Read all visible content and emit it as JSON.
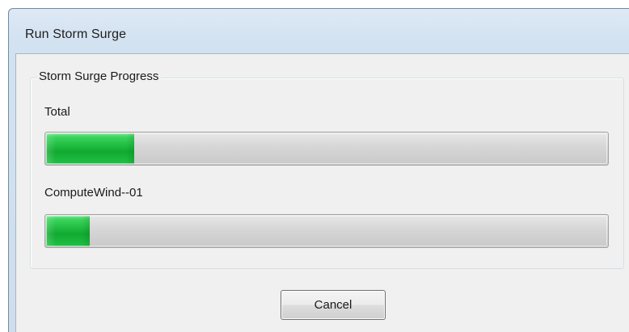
{
  "window": {
    "title": "Run Storm Surge"
  },
  "group": {
    "legend": "Storm Surge Progress"
  },
  "progress": {
    "total": {
      "label": "Total",
      "value_percent": 16
    },
    "task": {
      "label": "ComputeWind--01",
      "value_percent": 8
    }
  },
  "buttons": {
    "cancel_label": "Cancel"
  },
  "colors": {
    "progress_green": "#1bb83c",
    "track_gray": "#d2d2d2"
  }
}
